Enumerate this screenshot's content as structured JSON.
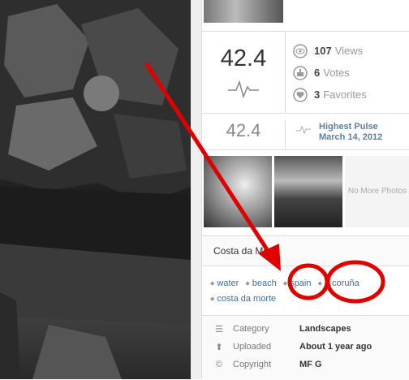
{
  "stats": {
    "score": "42.4",
    "views_count": "107",
    "views_label": "Views",
    "votes_count": "6",
    "votes_label": "Votes",
    "favorites_count": "3",
    "favorites_label": "Favorites"
  },
  "pulse": {
    "score": "42.4",
    "label": "Highest Pulse",
    "date": "March 14, 2012"
  },
  "thumbs": {
    "no_more": "No More Photos"
  },
  "photo_title": "Costa da Morte",
  "tags": [
    "water",
    "beach",
    "spain",
    "a coruña",
    "costa da morte"
  ],
  "meta": [
    {
      "icon": "category-icon",
      "label": "Category",
      "value": "Landscapes"
    },
    {
      "icon": "upload-icon",
      "label": "Uploaded",
      "value": "About 1 year ago"
    },
    {
      "icon": "copyright-icon",
      "label": "Copyright",
      "value": "MF G"
    }
  ],
  "annotation_color": "#e00000"
}
